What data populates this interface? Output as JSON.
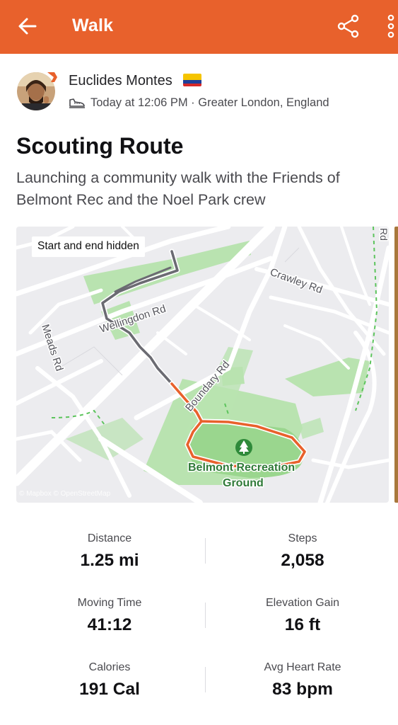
{
  "appbar": {
    "title": "Walk",
    "icons": {
      "back": "arrow-left-icon",
      "share": "share-icon",
      "more": "more-vertical-icon"
    },
    "color": "#e8612c"
  },
  "athlete": {
    "name": "Euclides Montes",
    "flag": "colombia-flag",
    "activity_icon": "walking-shoe-icon",
    "meta": "Today at 12:06 PM · Greater London, England"
  },
  "activity": {
    "title": "Scouting Route",
    "description": "Launching a community walk with the Friends of Belmont Rec and the Noel Park crew"
  },
  "map": {
    "badge": "Start and end hidden",
    "attribution": "© Mapbox © OpenStreetMap",
    "road_labels": [
      "Wellingdon Rd",
      "Crawley Rd",
      "Meads Rd",
      "Boundary Rd",
      "Rd"
    ],
    "park_label_line1": "Belmont Recreation",
    "park_label_line2": "Ground",
    "route_colors": {
      "hidden": "#6b6b72",
      "visible": "#e8612c"
    }
  },
  "stats": [
    {
      "label": "Distance",
      "value": "1.25 mi"
    },
    {
      "label": "Steps",
      "value": "2,058"
    },
    {
      "label": "Moving Time",
      "value": "41:12"
    },
    {
      "label": "Elevation Gain",
      "value": "16 ft"
    },
    {
      "label": "Calories",
      "value": "191 Cal"
    },
    {
      "label": "Avg Heart Rate",
      "value": "83 bpm"
    }
  ]
}
